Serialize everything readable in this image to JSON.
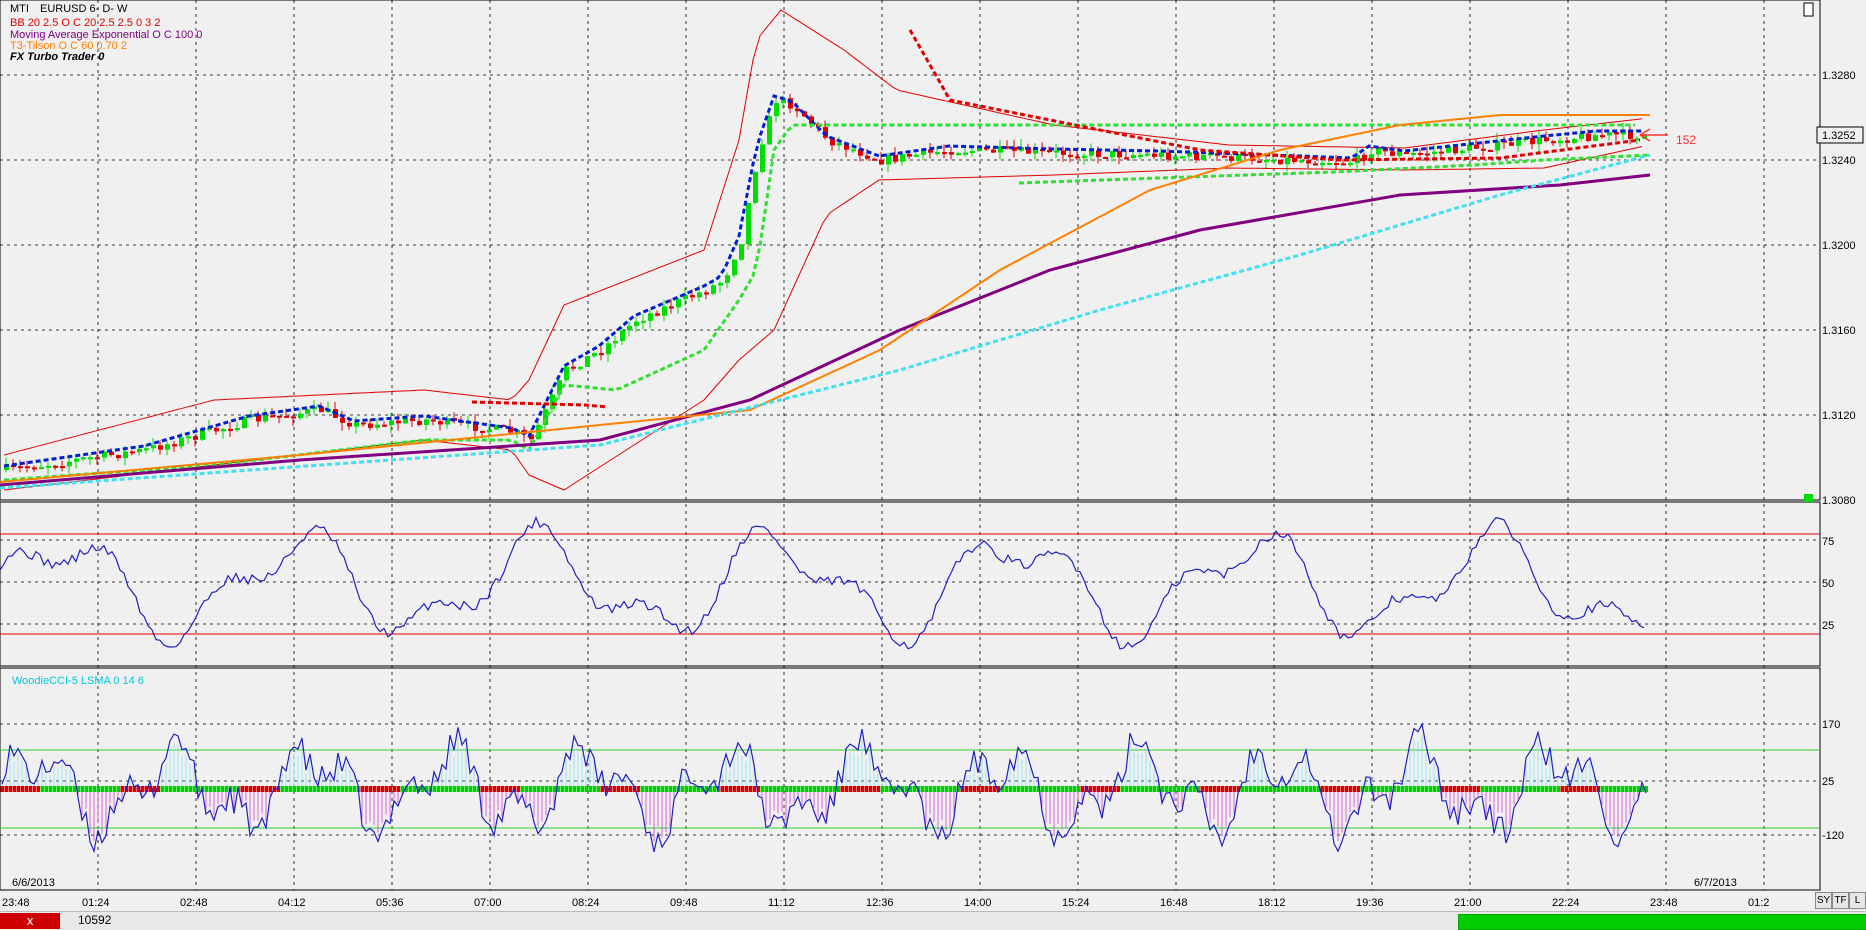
{
  "chart": {
    "symbol": "MTI",
    "instrument": "EURUSD 6- D- W",
    "legend": [
      {
        "text": "BB 20 2.5 O C 20 2.5 2.5 0 3 2",
        "color": "#e00000"
      },
      {
        "text": "Moving Average Exponential O C 100 0",
        "color": "#800080"
      },
      {
        "text": "T3-Tilson O C 60 0.70 2",
        "color": "#ff8000"
      },
      {
        "text": "FX Turbo Trader 0",
        "color": "#000000"
      }
    ],
    "price_labels": [
      "1.3280",
      "1.3240",
      "1.3200",
      "1.3160",
      "1.3120",
      "1.3080"
    ],
    "current_price": "1.3252",
    "side_label": "152",
    "osc_labels": [
      "75",
      "50",
      "25"
    ],
    "cci_title": "WoodieCCI-5 LSMA 0 14 6",
    "cci_labels": [
      "170",
      "25",
      "-120"
    ],
    "time_labels": [
      "23:48",
      "01:24",
      "02:48",
      "04:12",
      "05:36",
      "07:00",
      "08:24",
      "09:48",
      "11:12",
      "12:36",
      "14:00",
      "15:24",
      "16:48",
      "18:12",
      "19:36",
      "21:00",
      "22:24",
      "23:48",
      "01:2"
    ],
    "date_start": "6/6/2013",
    "date_end": "6/7/2013",
    "tool_buttons": [
      "SY",
      "TF",
      "L"
    ],
    "colors": {
      "background": "#f0f0f0",
      "bull": "#00dd00",
      "bear": "#dd0000",
      "bb": "#e00000",
      "ema": "#800080",
      "t3": "#ff8000",
      "trend": "#40e0f0",
      "osc": "#2020c0"
    }
  },
  "chart_data": [
    {
      "type": "candlestick",
      "title": "EURUSD 6- D- W",
      "ylim": [
        1.307,
        1.332
      ],
      "series": [
        {
          "name": "BB 20 2.5 O C 20 2.5 2.5 0 3 2"
        },
        {
          "name": "Moving Average Exponential O C 100 0"
        },
        {
          "name": "T3-Tilson O C 60 0.70 2"
        }
      ]
    },
    {
      "type": "line",
      "ylim": [
        0,
        100
      ],
      "reference_lines": [
        80,
        20
      ]
    },
    {
      "type": "line",
      "title": "WoodieCCI-5 LSMA 0 14 6",
      "reference_lines": [
        100,
        -100,
        0
      ]
    }
  ],
  "status": {
    "close_label": "x",
    "count": "10592"
  }
}
